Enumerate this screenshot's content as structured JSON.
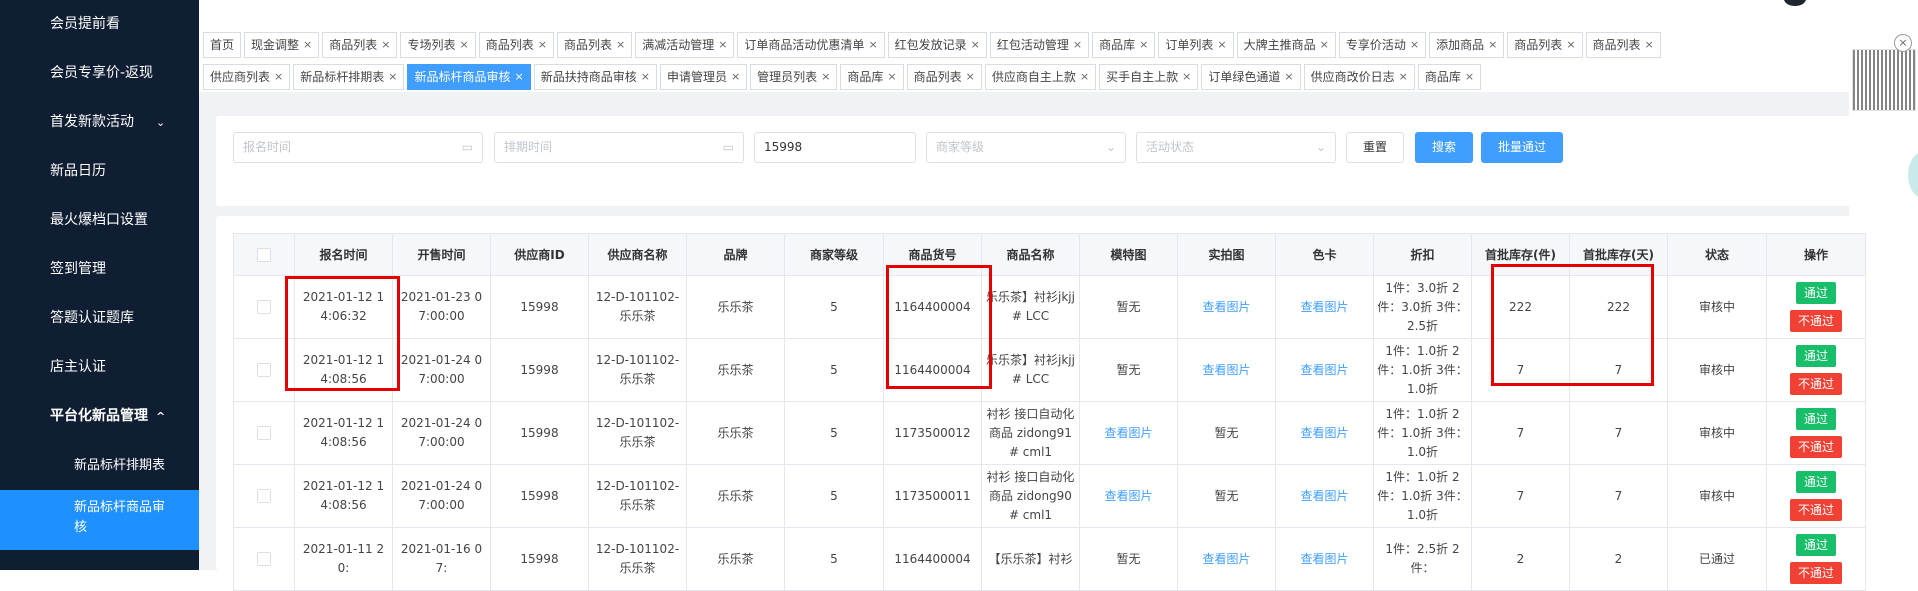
{
  "sidebar": {
    "items": [
      {
        "label": "会员提前看"
      },
      {
        "label": "会员专享价-返现"
      },
      {
        "label": "首发新款活动",
        "chev": "⌄"
      },
      {
        "label": "新品日历"
      },
      {
        "label": "最火爆档口设置"
      },
      {
        "label": "签到管理"
      },
      {
        "label": "答题认证题库"
      },
      {
        "label": "店主认证"
      },
      {
        "label": "平台化新品管理",
        "chev": "^"
      },
      {
        "label": "新品标杆排期表"
      },
      {
        "label": "新品标杆商品审核"
      }
    ]
  },
  "tabs": {
    "row1": [
      "首页",
      "现金调整",
      "商品列表",
      "专场列表",
      "商品列表",
      "商品列表",
      "满减活动管理",
      "订单商品活动优惠清单",
      "红包发放记录",
      "红包活动管理",
      "商品库",
      "订单列表",
      "大牌主推商品",
      "专享价活动",
      "添加商品",
      "商品列表",
      "商品列表"
    ],
    "row2": [
      "供应商列表",
      "新品标杆排期表",
      "新品标杆商品审核",
      "新品扶持商品审核",
      "申请管理员",
      "管理员列表",
      "商品库",
      "商品列表",
      "供应商自主上款",
      "买手自主上款",
      "订单绿色通道",
      "供应商改价日志",
      "商品库"
    ],
    "close": "×"
  },
  "filters": {
    "signup_time": "报名时间",
    "schedule_time": "排期时间",
    "supplier_id": "15998",
    "merchant_level": "商家等级",
    "activity_status": "活动状态",
    "reset": "重置",
    "search": "搜索",
    "batch_pass": "批量通过",
    "calendar_icon": "▭",
    "dropdown_icon": "⌄"
  },
  "table": {
    "headers": [
      "报名时间",
      "开售时间",
      "供应商ID",
      "供应商名称",
      "品牌",
      "商家等级",
      "商品货号",
      "商品名称",
      "模特图",
      "实拍图",
      "色卡",
      "折扣",
      "首批库存(件)",
      "首批库存(天)",
      "状态",
      "操作"
    ],
    "pass_label": "通过",
    "reject_label": "不通过",
    "rows": [
      [
        "2021-01-12 14:06:32",
        "2021-01-23 07:00:00",
        "15998",
        "12-D-101102-乐乐茶",
        "乐乐茶",
        "5",
        "1164400004",
        "乐乐茶】衬衫jkjj# LCC",
        "暂无",
        "查看图片",
        "查看图片",
        "1件：3.0折 2件：3.0折 3件：2.5折",
        "222",
        "222",
        "审核中"
      ],
      [
        "2021-01-12 14:08:56",
        "2021-01-24 07:00:00",
        "15998",
        "12-D-101102-乐乐茶",
        "乐乐茶",
        "5",
        "1164400004",
        "乐乐茶】衬衫jkjj# LCC",
        "暂无",
        "查看图片",
        "查看图片",
        "1件：1.0折 2件：1.0折 3件：1.0折",
        "7",
        "7",
        "审核中"
      ],
      [
        "2021-01-12 14:08:56",
        "2021-01-24 07:00:00",
        "15998",
        "12-D-101102-乐乐茶",
        "乐乐茶",
        "5",
        "1173500012",
        "衬衫 接口自动化商品 zidong91# cml1",
        "查看图片",
        "暂无",
        "查看图片",
        "1件：1.0折 2件：1.0折 3件：1.0折",
        "7",
        "7",
        "审核中"
      ],
      [
        "2021-01-12 14:08:56",
        "2021-01-24 07:00:00",
        "15998",
        "12-D-101102-乐乐茶",
        "乐乐茶",
        "5",
        "1173500011",
        "衬衫 接口自动化商品 zidong90# cml1",
        "查看图片",
        "暂无",
        "查看图片",
        "1件：1.0折 2件：1.0折 3件：1.0折",
        "7",
        "7",
        "审核中"
      ],
      [
        "2021-01-11 20:",
        "2021-01-16 07:",
        "15998",
        "12-D-101102-乐乐茶",
        "乐乐茶",
        "5",
        "1164400004",
        "【乐乐茶】衬衫",
        "暂无",
        "查看图片",
        "查看图片",
        "1件：2.5折 2件：",
        "2",
        "2",
        "已通过"
      ]
    ]
  },
  "colors": {
    "sidebar_bg": "#0f1e32",
    "active_blue": "#409eff",
    "pass_green": "#19be6b",
    "reject_red": "#f04134",
    "highlight_red": "#e50000"
  }
}
